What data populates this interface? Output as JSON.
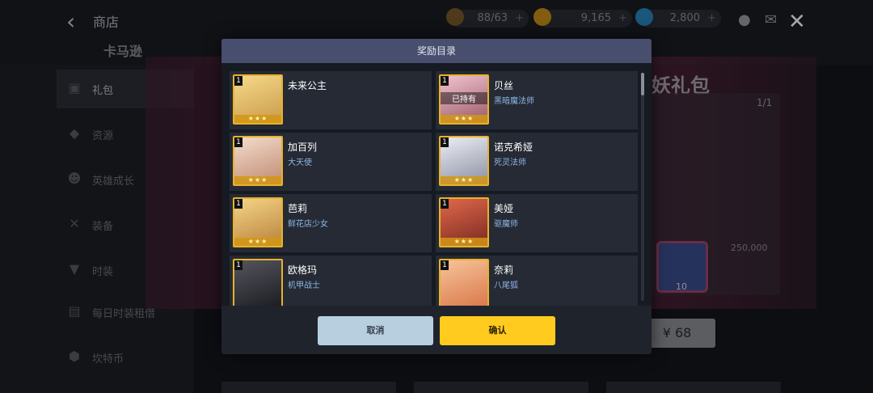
{
  "topbar": {
    "back_icon": "chevron-left-icon",
    "title": "商店",
    "resources": [
      {
        "icon": "stamina-cup-icon",
        "value": "88/63",
        "color": "#c8a24a"
      },
      {
        "icon": "gold-coin-icon",
        "value": "9,165",
        "color": "#e0a81c"
      },
      {
        "icon": "diamond-icon",
        "value": "2,800",
        "color": "#36a7e8"
      }
    ],
    "tab": "卡马逊"
  },
  "sidebar": {
    "items": [
      {
        "label": "礼包",
        "icon": "gift-icon",
        "active": true
      },
      {
        "label": "资源",
        "icon": "diamond-icon"
      },
      {
        "label": "英雄成长",
        "icon": "hero-face-icon"
      },
      {
        "label": "装备",
        "icon": "sword-icon"
      },
      {
        "label": "时装",
        "icon": "shirt-icon"
      },
      {
        "label": "每日时装租借",
        "icon": "costume-icon"
      },
      {
        "label": "坎特币",
        "icon": "hexagon-coin-icon"
      }
    ]
  },
  "background": {
    "banner_title": "妖礼包",
    "counter": "1/1",
    "chest_count": "10",
    "coin_amount": "250,000",
    "price": "¥ 68"
  },
  "modal": {
    "title": "奖励目录",
    "heroes": [
      {
        "name": "未来公主",
        "class": "",
        "level": "1",
        "owned": "",
        "stars": "★★★",
        "color": "#e6c27a"
      },
      {
        "name": "贝丝",
        "class": "黑暗魔法师",
        "level": "1",
        "owned": "已持有",
        "stars": "★★★",
        "color": "#c98aa0"
      },
      {
        "name": "加百列",
        "class": "大天使",
        "level": "1",
        "owned": "",
        "stars": "★★★",
        "color": "#e6b89a"
      },
      {
        "name": "诺克希娅",
        "class": "死灵法师",
        "level": "1",
        "owned": "",
        "stars": "★★★",
        "color": "#cfd2dc"
      },
      {
        "name": "芭莉",
        "class": "鲜花店少女",
        "level": "1",
        "owned": "",
        "stars": "★★★",
        "color": "#e0b060"
      },
      {
        "name": "美娅",
        "class": "驱魔师",
        "level": "1",
        "owned": "",
        "stars": "★★★",
        "color": "#c8503a"
      },
      {
        "name": "欧格玛",
        "class": "机甲战士",
        "level": "1",
        "owned": "",
        "stars": "",
        "color": "#3a3a40"
      },
      {
        "name": "奈莉",
        "class": "八尾狐",
        "level": "1",
        "owned": "",
        "stars": "",
        "color": "#f0a070"
      }
    ],
    "cancel_label": "取消",
    "confirm_label": "确认"
  }
}
